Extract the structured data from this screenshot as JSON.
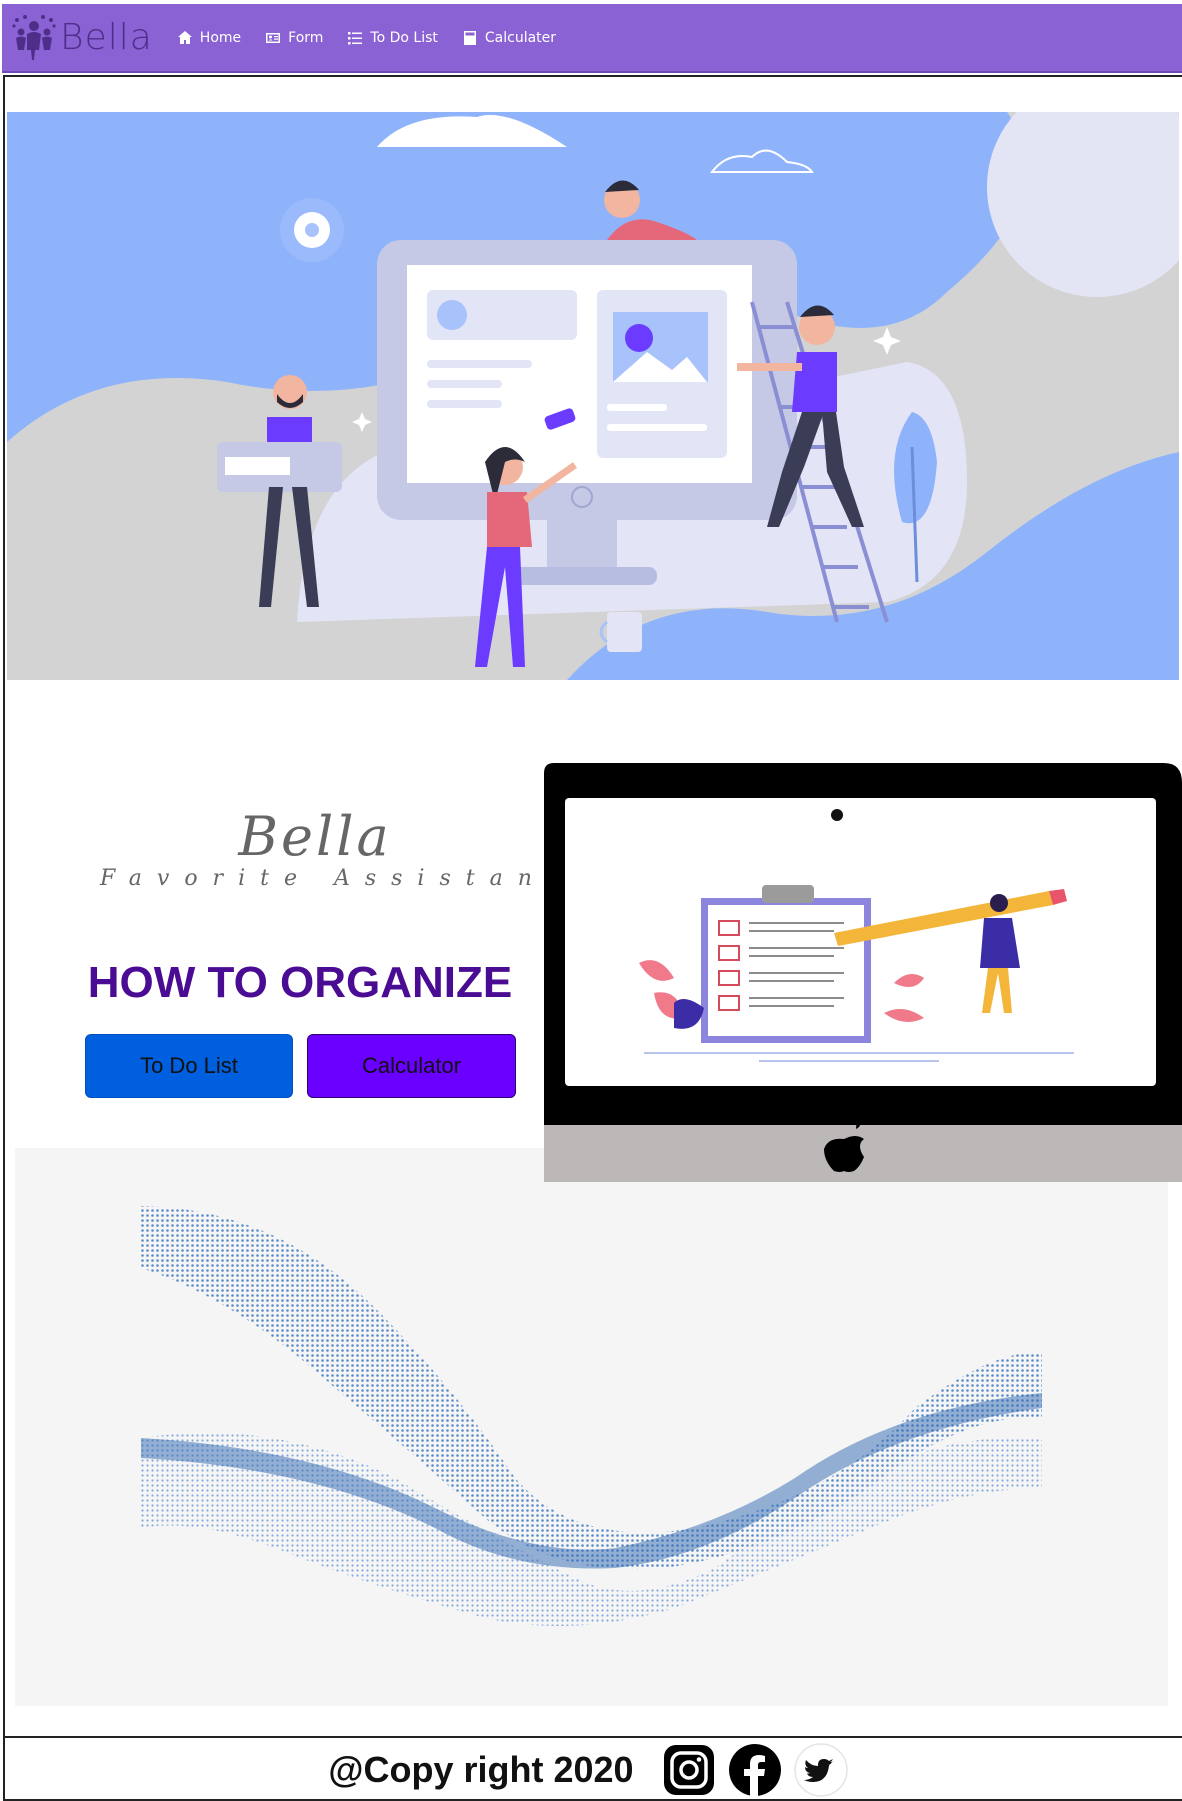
{
  "nav": {
    "brand": "Bella",
    "items": [
      {
        "label": "Home",
        "icon": "home-icon"
      },
      {
        "label": "Form",
        "icon": "id-card-icon"
      },
      {
        "label": "To Do List",
        "icon": "list-icon"
      },
      {
        "label": "Calculater",
        "icon": "calculator-icon"
      }
    ]
  },
  "hero": {
    "illustration": "team-building-website-illustration"
  },
  "middle": {
    "logo_title": "Bella",
    "logo_subtitle": "Favorite Assistance",
    "heading": "HOW TO ORGANIZE",
    "buttons": {
      "todo": "To Do List",
      "calc": "Calculator"
    }
  },
  "footer": {
    "copyright": "@Copy right 2020",
    "social": [
      "instagram-icon",
      "facebook-icon",
      "twitter-icon"
    ]
  },
  "colors": {
    "navbar": "#8b62d4",
    "heading": "#4b0c94",
    "todo_button": "#005fde",
    "calc_button": "#6a00ff"
  }
}
